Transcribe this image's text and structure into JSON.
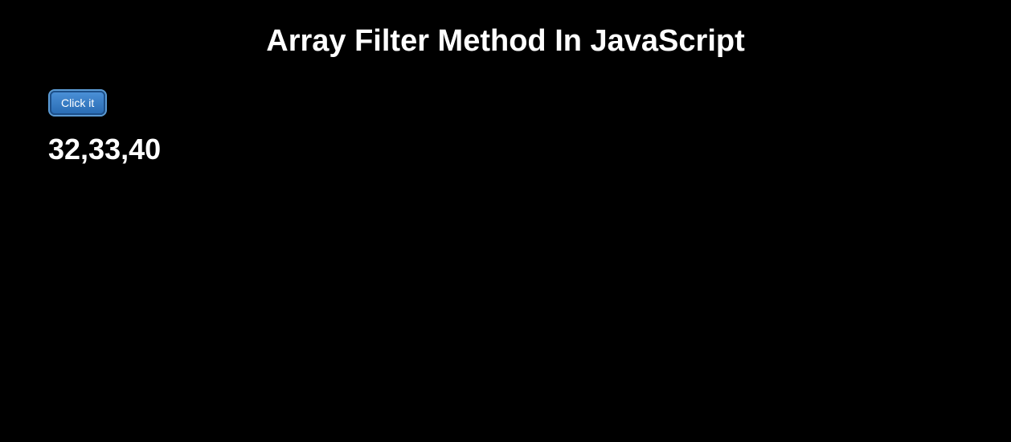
{
  "header": {
    "title": "Array Filter Method In JavaScript"
  },
  "controls": {
    "button_label": "Click it"
  },
  "output": {
    "result": "32,33,40"
  }
}
